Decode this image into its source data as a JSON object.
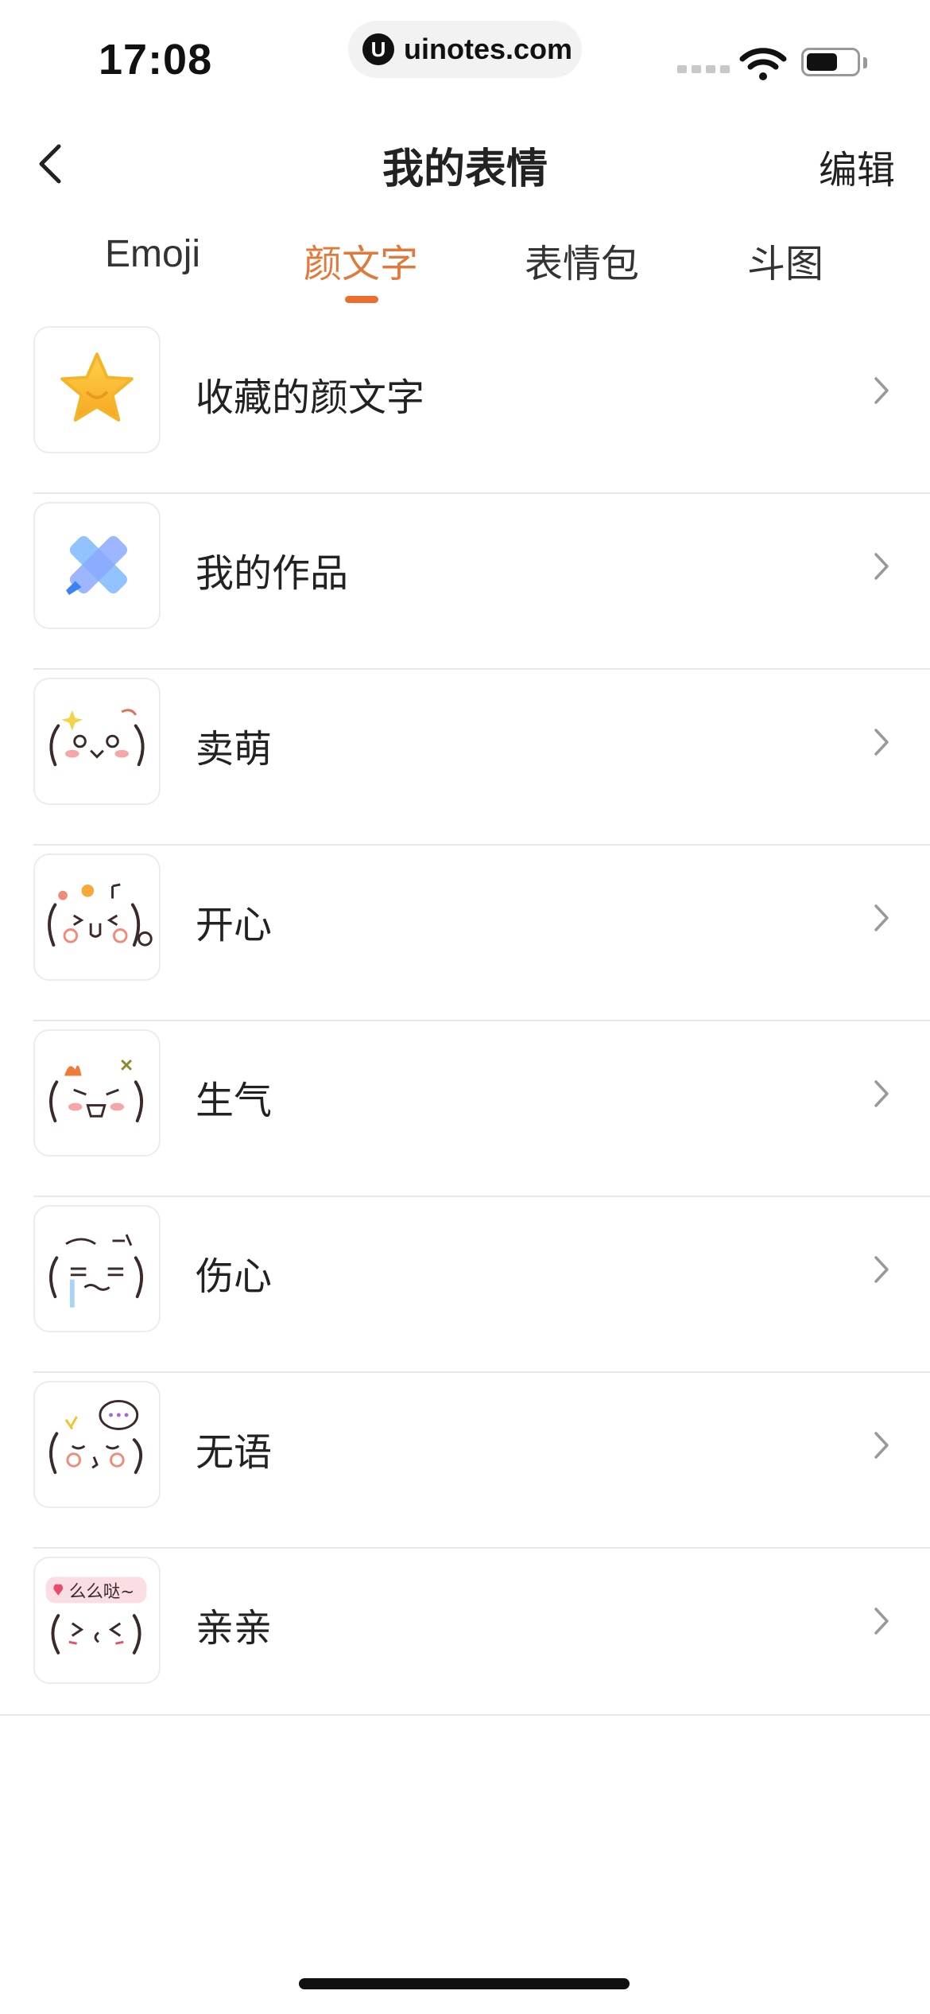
{
  "status_bar": {
    "time": "17:08",
    "url": "uinotes.com",
    "url_logo": "U"
  },
  "header": {
    "title": "我的表情",
    "edit_label": "编辑"
  },
  "tabs": [
    {
      "label": "Emoji"
    },
    {
      "label": "颜文字",
      "active": true
    },
    {
      "label": "表情包"
    },
    {
      "label": "斗图"
    }
  ],
  "list": [
    {
      "label": "收藏的颜文字",
      "icon": "star-icon"
    },
    {
      "label": "我的作品",
      "icon": "pencil-icon"
    },
    {
      "label": "卖萌",
      "icon": "cute-face-icon"
    },
    {
      "label": "开心",
      "icon": "happy-face-icon"
    },
    {
      "label": "生气",
      "icon": "angry-face-icon"
    },
    {
      "label": "伤心",
      "icon": "sad-face-icon"
    },
    {
      "label": "无语",
      "icon": "speechless-face-icon"
    },
    {
      "label": "亲亲",
      "icon": "kiss-face-icon",
      "sticker_text": "么么哒~"
    }
  ],
  "colors": {
    "accent": "#e07a3c",
    "indicator": "#ea6f2f",
    "divider": "#e8e8e8"
  }
}
